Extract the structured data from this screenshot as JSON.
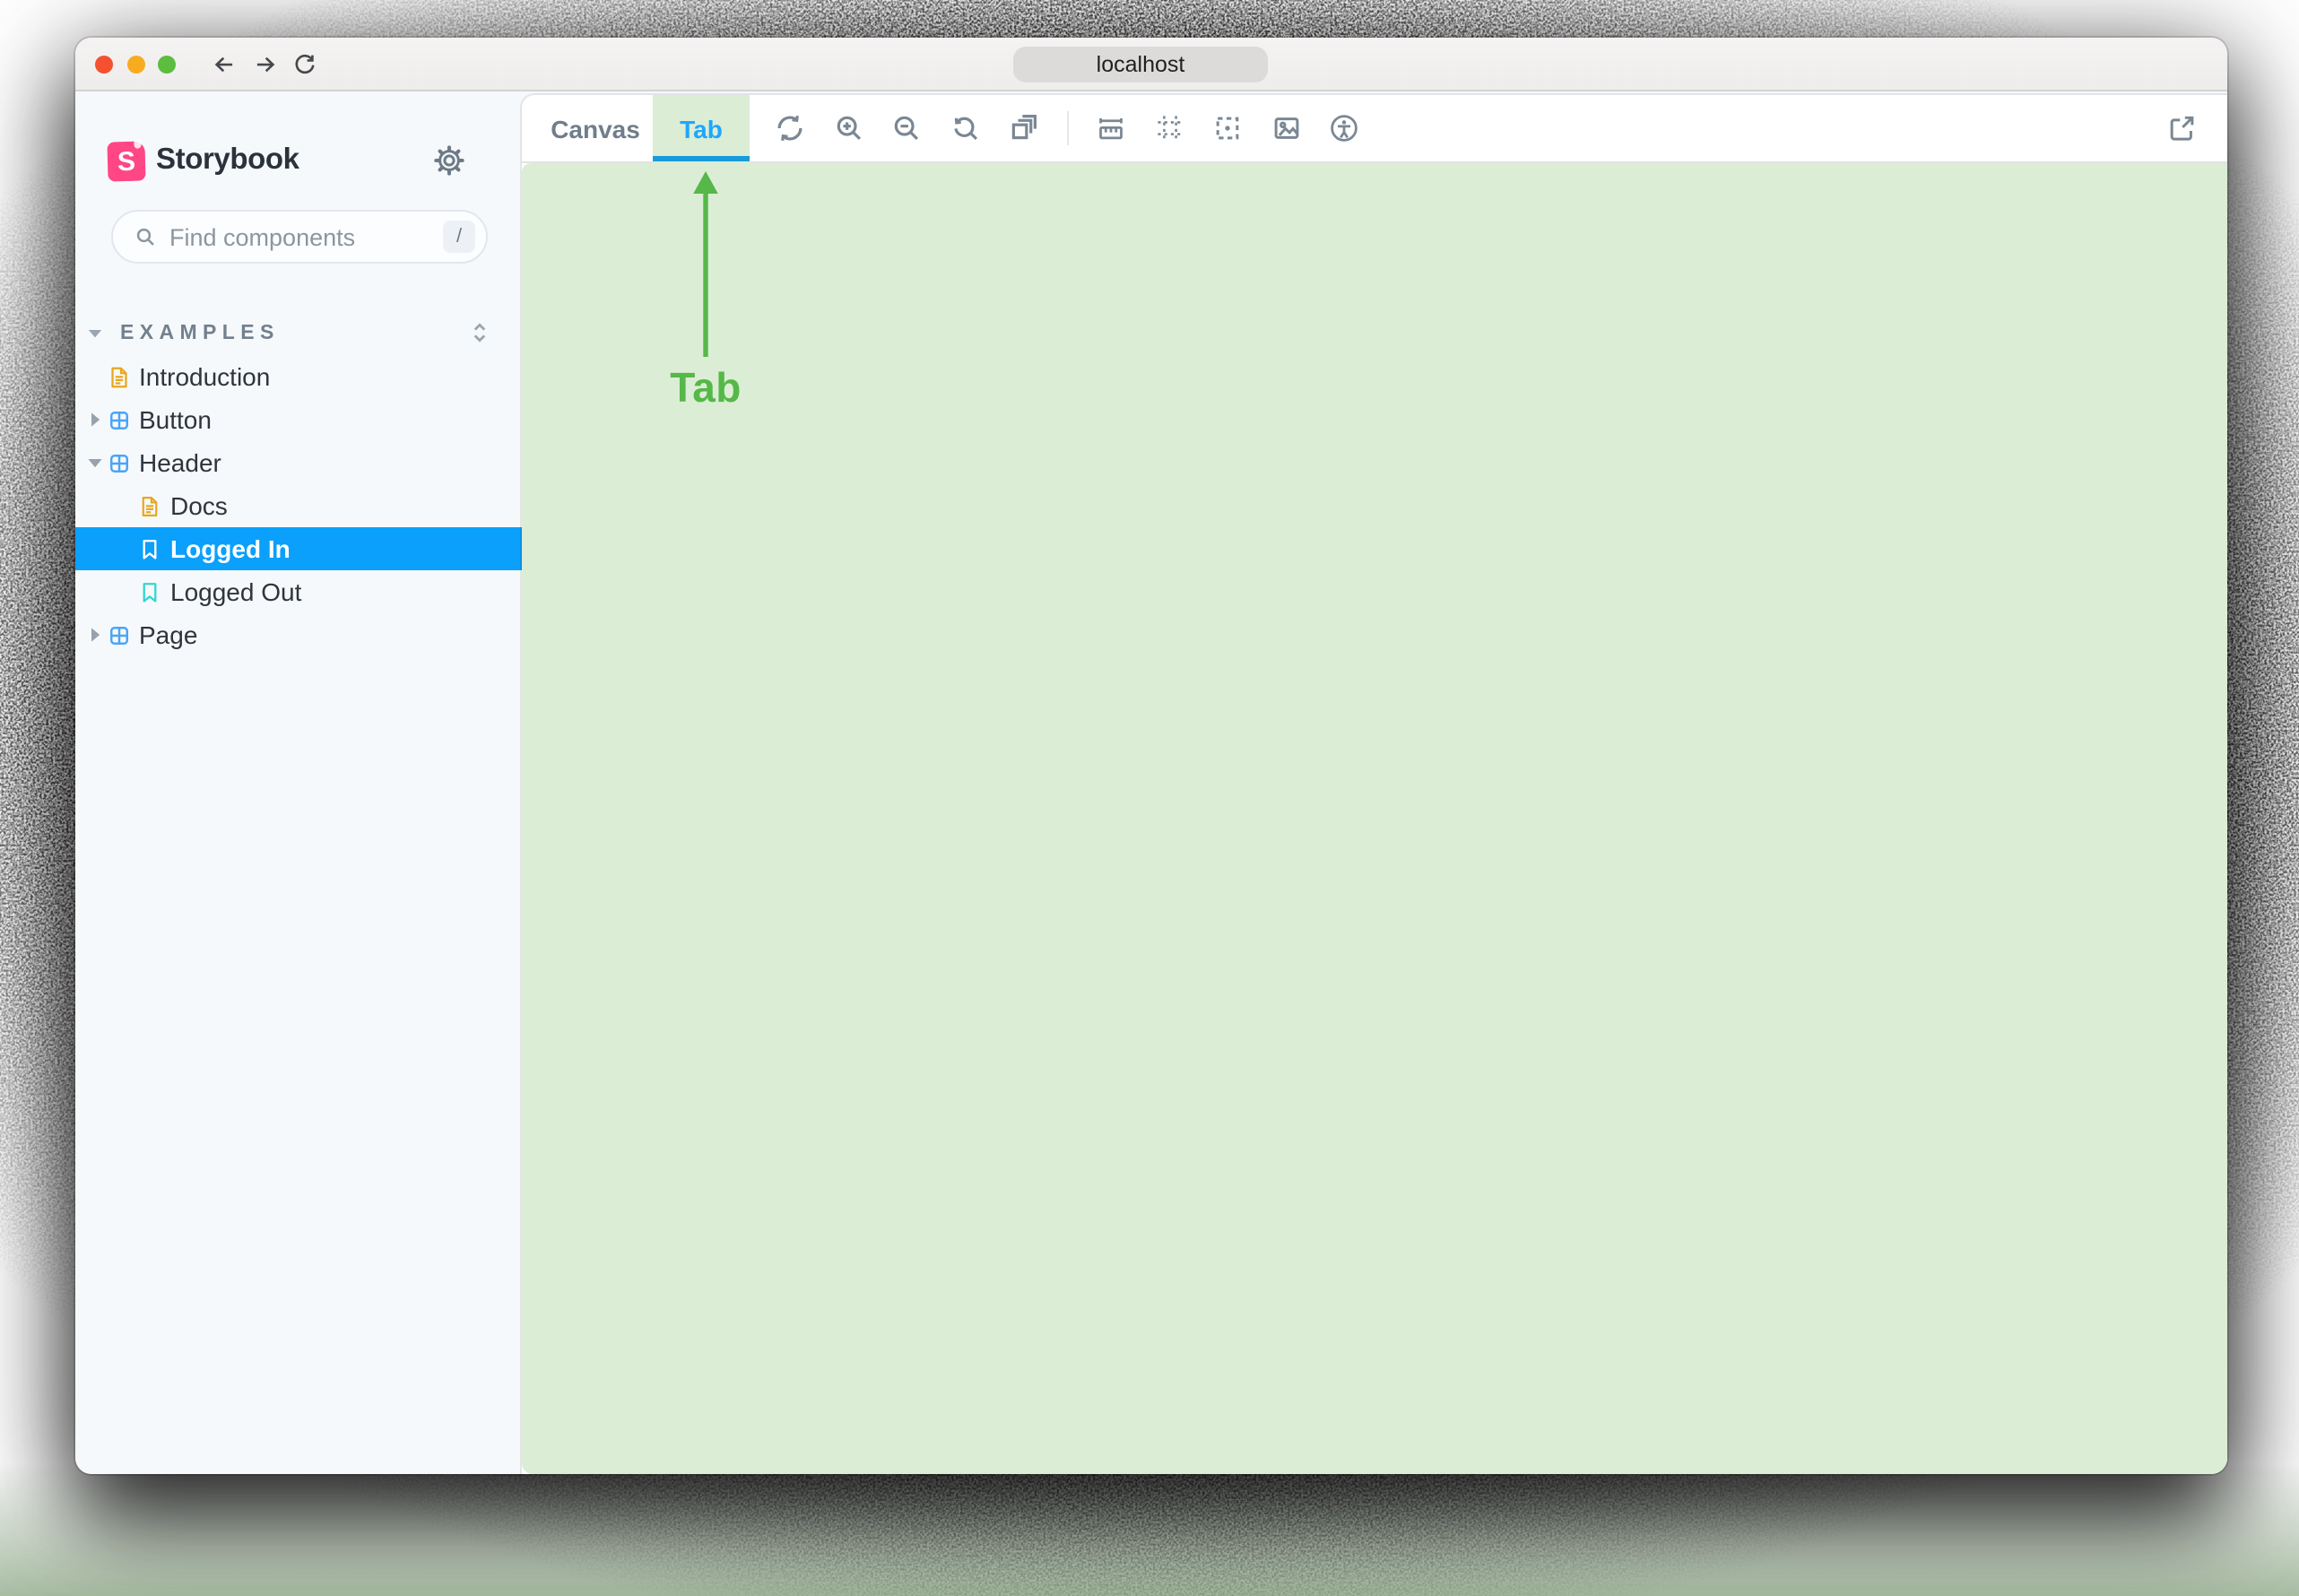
{
  "browser": {
    "url": "localhost",
    "back_tooltip": "back",
    "forward_tooltip": "forward",
    "reload_tooltip": "reload"
  },
  "sidebar": {
    "brand": "Storybook",
    "brand_initial": "S",
    "search_placeholder": "Find components",
    "search_shortcut": "/",
    "section_label": "EXAMPLES",
    "items": {
      "introduction": "Introduction",
      "button": "Button",
      "header": "Header",
      "docs": "Docs",
      "logged_in": "Logged In",
      "logged_out": "Logged Out",
      "page": "Page"
    }
  },
  "main": {
    "tabs": {
      "canvas": "Canvas",
      "tab": "Tab"
    },
    "toolbar_icons": [
      "remount",
      "zoom-in",
      "zoom-out",
      "zoom-reset",
      "viewport",
      "measure",
      "grid",
      "outline",
      "backgrounds",
      "accessibility"
    ],
    "external_icon": "open-canvas-in-new-tab"
  },
  "annotation": {
    "label": "Tab"
  },
  "colors": {
    "selected_blue": "#0AA0FC",
    "tab_blue": "#1EA7FD",
    "tab_underline": "#189BDC",
    "canvas_green": "#DCEDD6",
    "annotation_green": "#55B848",
    "brand_pink": "#FF4785",
    "doc_orange": "#E9A71E",
    "story_teal": "#37D5D3",
    "component_blue": "#4AA4F8",
    "sidebar_bg": "#F6F9FC"
  }
}
